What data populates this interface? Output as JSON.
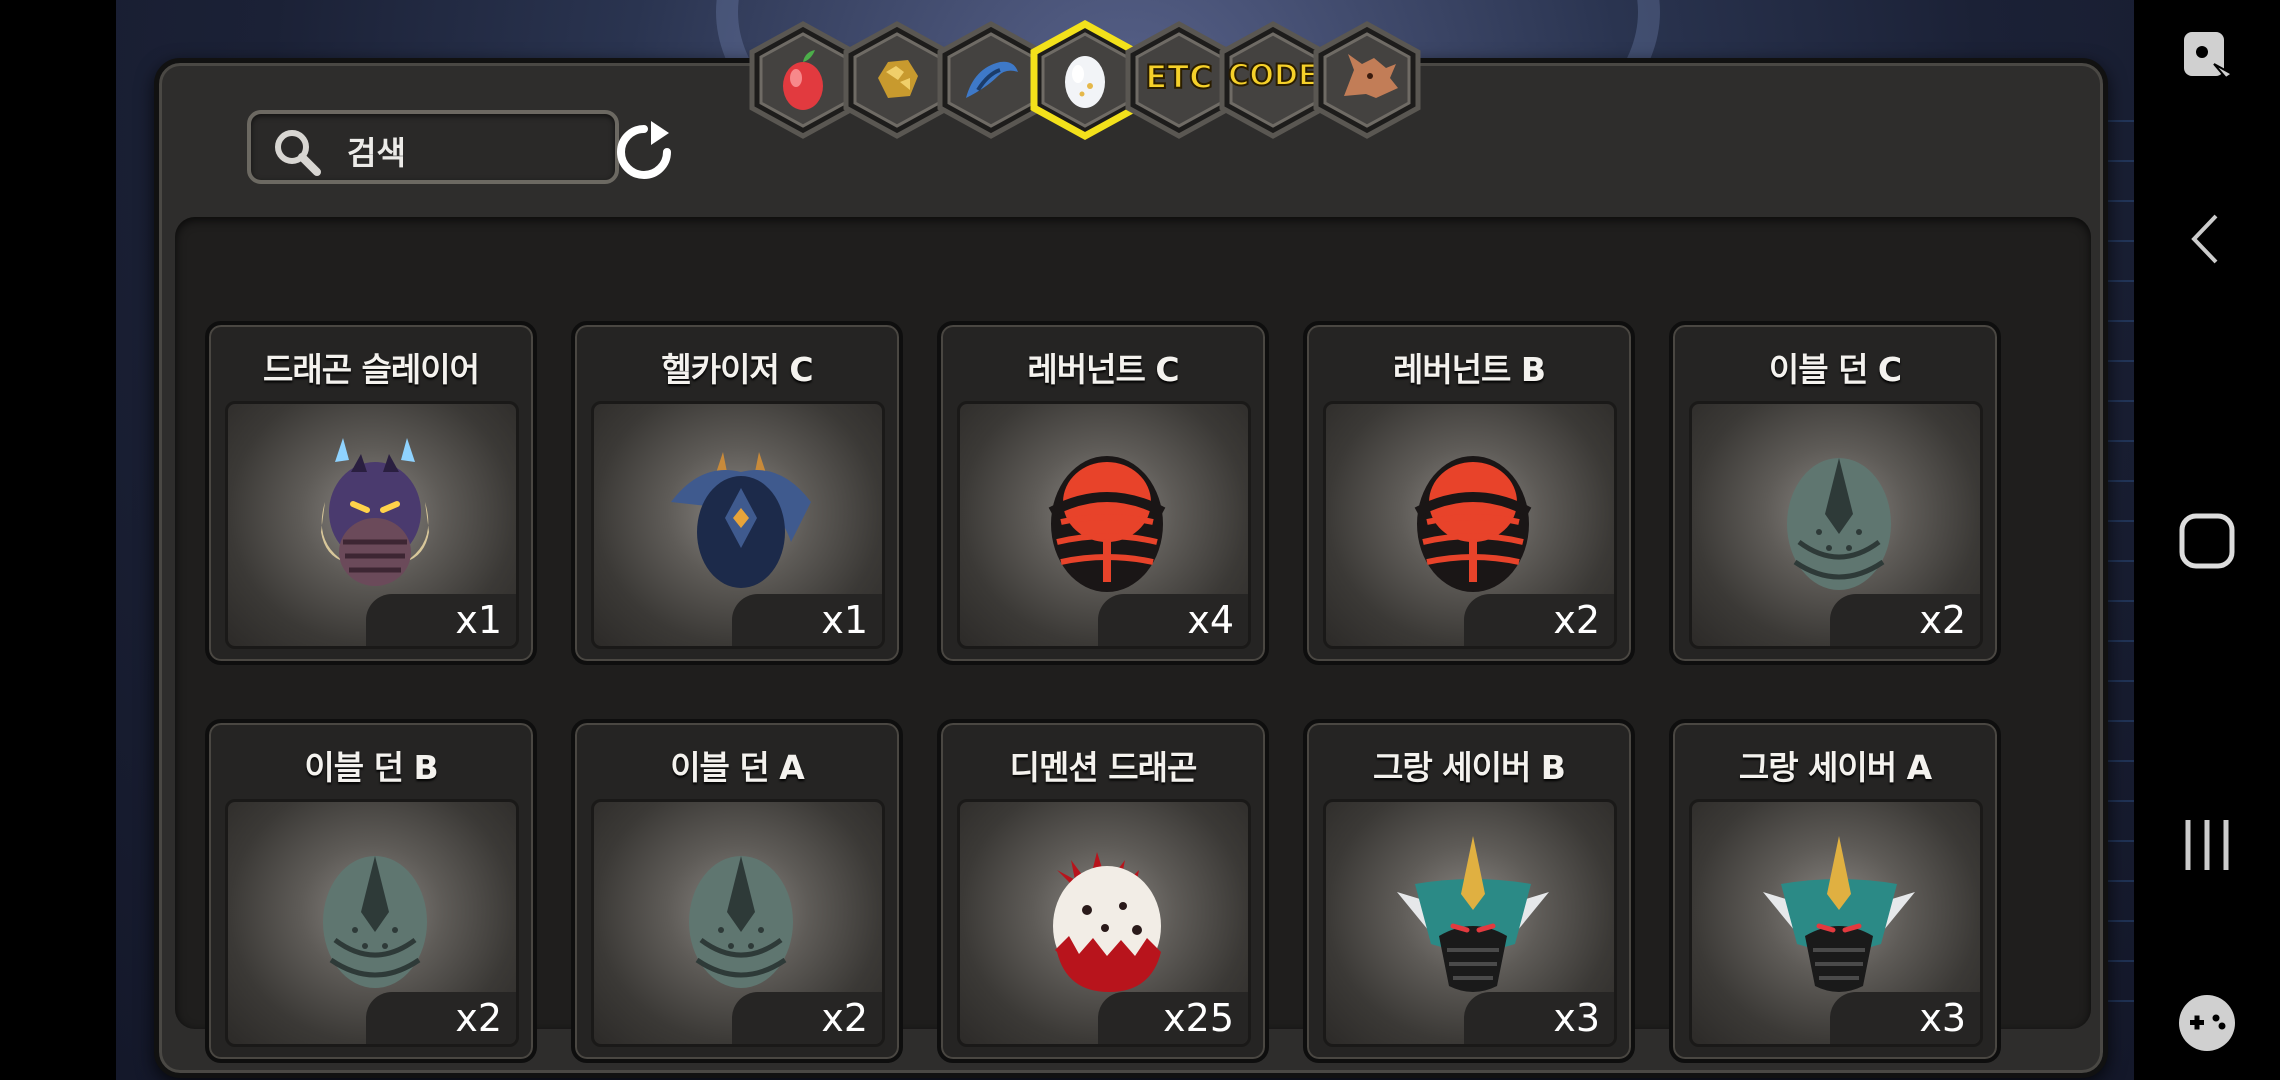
{
  "search": {
    "placeholder": "검색"
  },
  "tabs": [
    {
      "name": "fruit",
      "label": "",
      "icon": "fruit-icon",
      "active": false
    },
    {
      "name": "gold-ore",
      "label": "",
      "icon": "gold-ore-icon",
      "active": false
    },
    {
      "name": "dragon-scale",
      "label": "",
      "icon": "dragon-scale-icon",
      "active": false
    },
    {
      "name": "egg",
      "label": "",
      "icon": "egg-icon",
      "active": true
    },
    {
      "name": "etc",
      "label": "ETC",
      "icon": "",
      "active": false
    },
    {
      "name": "code",
      "label": "CODE",
      "icon": "",
      "active": false
    },
    {
      "name": "dragon",
      "label": "",
      "icon": "dragon-head-icon",
      "active": false
    }
  ],
  "items": [
    {
      "name": "드래곤 슬레이어",
      "qty": "x1",
      "icon": "dragon-slayer-icon",
      "colors": [
        "#4a3a6e",
        "#2a1f40"
      ]
    },
    {
      "name": "헬카이저 C",
      "qty": "x1",
      "icon": "helkaiser-icon",
      "colors": [
        "#3f5a8e",
        "#1c2a4a"
      ]
    },
    {
      "name": "레버넌트 C",
      "qty": "x4",
      "icon": "revenant-egg-icon",
      "colors": [
        "#e8432a",
        "#1a1616"
      ]
    },
    {
      "name": "레버넌트 B",
      "qty": "x2",
      "icon": "revenant-egg-icon",
      "colors": [
        "#e8432a",
        "#1a1616"
      ]
    },
    {
      "name": "이블 던 C",
      "qty": "x2",
      "icon": "evil-dawn-egg-icon",
      "colors": [
        "#5f7670",
        "#2e3a38"
      ]
    },
    {
      "name": "이블 던 B",
      "qty": "x2",
      "icon": "evil-dawn-egg-icon",
      "colors": [
        "#5f7670",
        "#2e3a38"
      ]
    },
    {
      "name": "이블 던 A",
      "qty": "x2",
      "icon": "evil-dawn-egg-icon",
      "colors": [
        "#5f7670",
        "#2e3a38"
      ]
    },
    {
      "name": "디멘션 드래곤",
      "qty": "x25",
      "icon": "dimension-dragon-egg-icon",
      "colors": [
        "#f2ede6",
        "#b8141c"
      ]
    },
    {
      "name": "그랑 세이버 B",
      "qty": "x3",
      "icon": "grand-saber-icon",
      "colors": [
        "#2b8a86",
        "#1a1a1a"
      ]
    },
    {
      "name": "그랑 세이버 A",
      "qty": "x3",
      "icon": "grand-saber-icon",
      "colors": [
        "#2b8a86",
        "#1a1a1a"
      ]
    }
  ],
  "accent": {
    "active_tab": "#f3e11b",
    "close": "#c8141b"
  }
}
